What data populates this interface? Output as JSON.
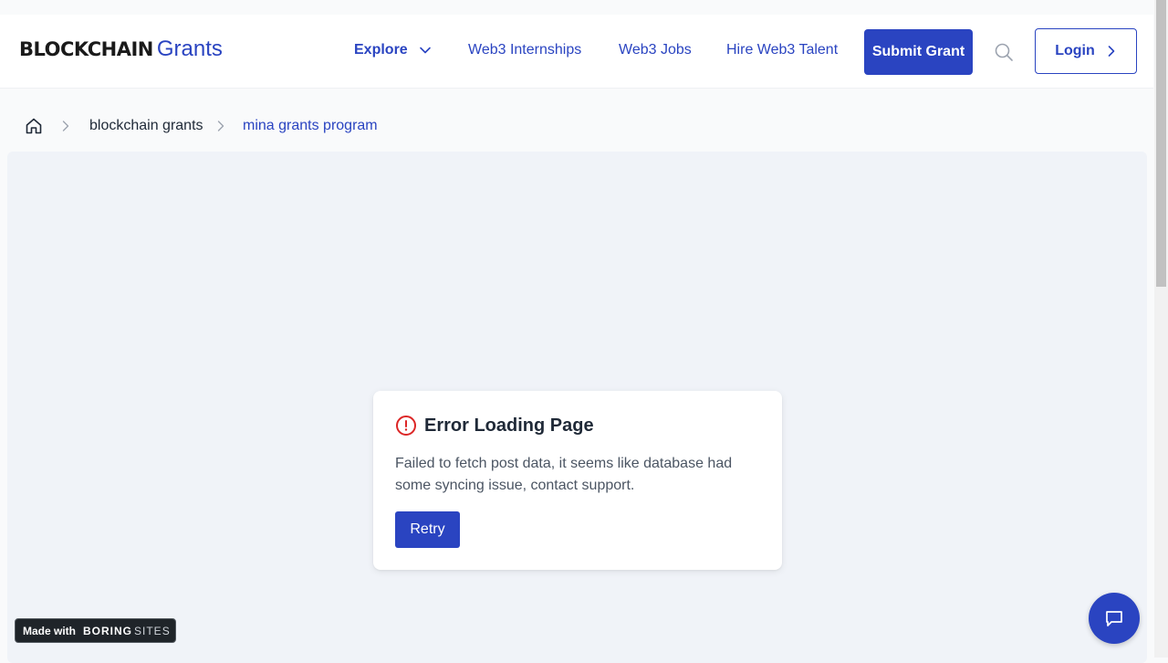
{
  "header": {
    "logo_bold": "BLOCKCHAIN",
    "logo_light": "Grants",
    "nav": {
      "explore": "Explore",
      "internships": "Web3 Internships",
      "jobs": "Web3 Jobs",
      "talent": "Hire Web3 Talent"
    },
    "submit_label": "Submit Grant",
    "login_label": "Login"
  },
  "breadcrumb": {
    "home_icon": "home-icon",
    "items": [
      "blockchain grants",
      "mina grants program"
    ]
  },
  "error": {
    "title": "Error Loading Page",
    "message": "Failed to fetch post data, it seems like database had some syncing issue, contact support.",
    "retry_label": "Retry"
  },
  "footer_badge": {
    "prefix": "Made with",
    "brand_bold": "BORING",
    "brand_light": "SITES"
  },
  "icons": {
    "chevron": "chevron-down-icon",
    "search": "search-icon",
    "chat": "chat-icon",
    "alert": "alert-circle-icon"
  },
  "colors": {
    "primary": "#2a44c1",
    "error": "#dc2626",
    "background": "#f0f3f8"
  }
}
